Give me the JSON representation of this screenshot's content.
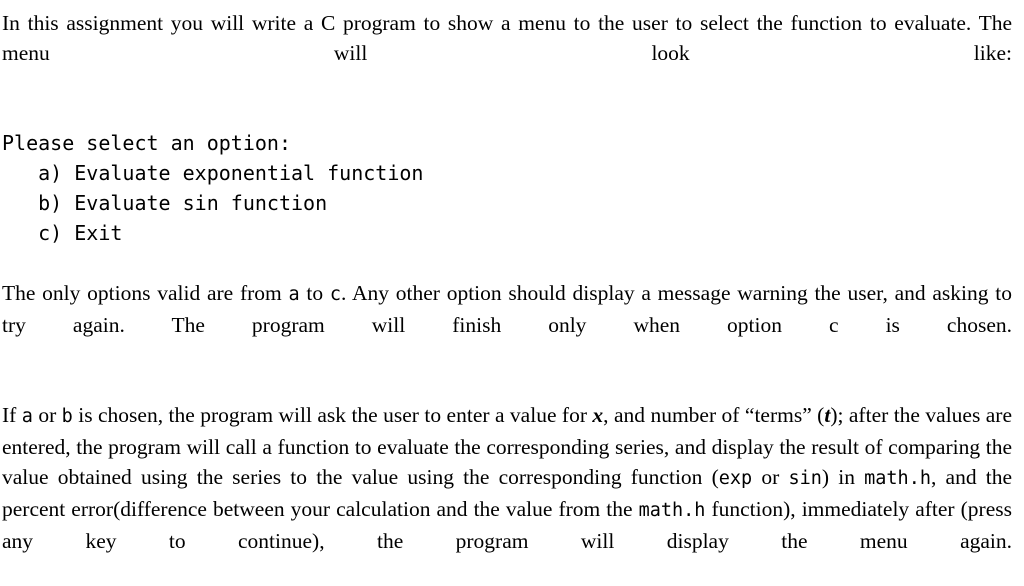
{
  "document": {
    "type": "assignment-description",
    "background_color": "#ffffff",
    "text_color": "#000000",
    "paragraphs": {
      "intro": {
        "full_text": "In this assignment you will write a C program to show a menu to the user to select the function to evaluate.  The menu will look like:",
        "segment_1": "In this assignment you will write a C program to show a menu to the user to select the function to evaluate.  The menu will look like:"
      },
      "menu_listing": {
        "prompt": "Please select an option:",
        "options": [
          "   a) Evaluate exponential function",
          "   b) Evaluate sin function",
          "   c) Exit"
        ],
        "option_labels": [
          "a",
          "b",
          "c"
        ],
        "option_texts": [
          "Evaluate exponential function",
          "Evaluate sin function",
          "Exit"
        ]
      },
      "valid_options": {
        "part_1": "The only options valid are from ",
        "code_a": "a",
        "part_2": " to ",
        "code_c": "c",
        "part_3": ". Any other option should display a message warning the user, and asking to try again. The program will finish only when option c is chosen."
      },
      "behavior": {
        "part_1": "If ",
        "code_a": "a",
        "part_2": " or ",
        "code_b": "b",
        "part_3": "  is chosen, the program will ask the user to enter a value for ",
        "var_x": "x",
        "part_4": ", and number of “terms” (",
        "var_t": "t",
        "part_5": "); after the values are entered, the program will call a function to evaluate the corresponding series, and display the result of comparing the value obtained using the series to the value using the corresponding function (",
        "code_exp": "exp",
        "part_6": " or ",
        "code_sin": "sin",
        "part_7": ") in ",
        "code_mathh_1": "math.h",
        "part_8": ", and the percent error(difference between your calculation and the value from the ",
        "code_mathh_2": "math.h",
        "part_9": " function), immediately after (press any key to continue), the program will display the menu again."
      }
    }
  }
}
